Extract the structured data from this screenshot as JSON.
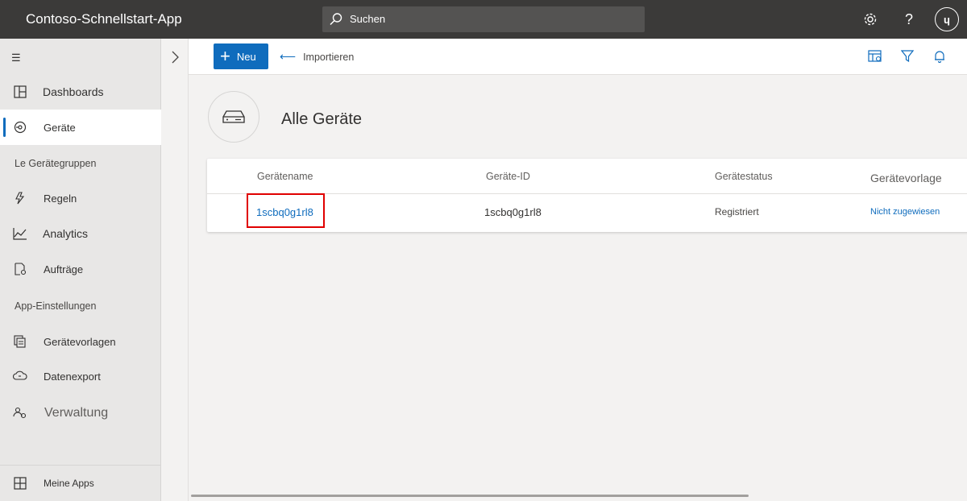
{
  "header": {
    "app_title": "Contoso-Schnellstart-App",
    "search_placeholder": "Suchen",
    "avatar_initials": "ɥ",
    "icons": [
      "settings-icon",
      "help-icon"
    ]
  },
  "sidebar": {
    "items": [
      {
        "label": "Dashboards",
        "icon": "dashboard-icon"
      },
      {
        "label": "Geräte",
        "icon": "devices-icon",
        "active": true
      },
      {
        "label": "Le Gerätegruppen"
      },
      {
        "label": "Regeln",
        "icon": "rules-icon"
      },
      {
        "label": "Analytics",
        "icon": "analytics-icon"
      },
      {
        "label": "Aufträge",
        "icon": "jobs-icon"
      },
      {
        "label": "App-Einstellungen"
      },
      {
        "label": "Gerätevorlagen",
        "icon": "device-templates-icon"
      },
      {
        "label": "Datenexport",
        "icon": "data-export-icon"
      },
      {
        "label": "Verwaltung",
        "icon": "administration-icon"
      }
    ],
    "footer_label": "Meine Apps"
  },
  "commandbar": {
    "new_label": "Neu",
    "import_label": "Importieren"
  },
  "main": {
    "page_title": "Alle Geräte",
    "table": {
      "columns": [
        "Gerätename",
        "Geräte-ID",
        "Gerätestatus",
        "Gerätevorlage"
      ],
      "rows": [
        [
          "1scbq0g1rl8",
          "1scbq0g1rl8",
          "Registriert",
          "Nicht zugewiesen"
        ]
      ]
    }
  },
  "colors": {
    "accent": "#0f6cbd",
    "topbar": "#3b3a39",
    "highlight": "#e00000"
  }
}
